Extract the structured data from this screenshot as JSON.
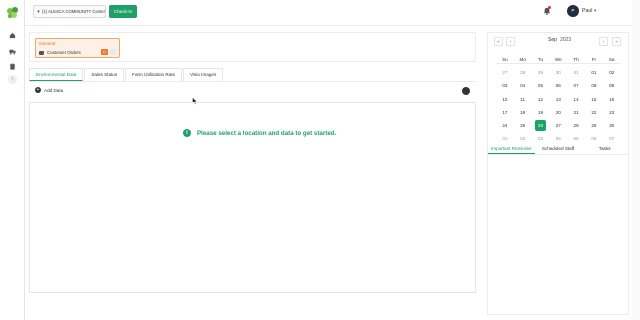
{
  "header": {
    "location": "(1) ALESCA COMMUNITY Center",
    "checkin_label": "Check-In",
    "user_initial": "P",
    "user_name": "Paul",
    "caret": "▾"
  },
  "sidebar": {
    "items": [
      {
        "icon": "home-icon"
      },
      {
        "icon": "truck-icon"
      },
      {
        "icon": "clipboard-icon"
      }
    ],
    "toggle": "›"
  },
  "summary": {
    "title": "General",
    "orders_label": "Customer Orders",
    "orders_count": "0"
  },
  "tabs": [
    {
      "label": "Environmental Data",
      "active": true
    },
    {
      "label": "Sales Status",
      "active": false
    },
    {
      "label": "Farm Utilization Rate",
      "active": false
    },
    {
      "label": "Visio Images",
      "active": false
    }
  ],
  "toolbar": {
    "add_data_label": "Add Data",
    "plus": "+"
  },
  "empty_state": {
    "icon": "i",
    "message": "Please select a location and data to get started."
  },
  "calendar": {
    "month": "Sep",
    "year": "2023",
    "nav": [
      "«",
      "‹",
      "›",
      "»"
    ],
    "weekdays": [
      "Su",
      "Mo",
      "Tu",
      "We",
      "Th",
      "Fr",
      "Sa"
    ],
    "weeks": [
      [
        "27",
        "28",
        "29",
        "30",
        "31",
        "01",
        "02"
      ],
      [
        "03",
        "04",
        "05",
        "06",
        "07",
        "08",
        "09"
      ],
      [
        "10",
        "11",
        "12",
        "13",
        "14",
        "15",
        "16"
      ],
      [
        "17",
        "18",
        "19",
        "20",
        "21",
        "22",
        "23"
      ],
      [
        "24",
        "25",
        "26",
        "27",
        "28",
        "29",
        "30"
      ],
      [
        "01",
        "02",
        "03",
        "04",
        "05",
        "06",
        "07"
      ]
    ],
    "today": "26"
  },
  "right_tabs": [
    {
      "label": "Important Reminder",
      "active": true
    },
    {
      "label": "Scheduled Staff",
      "active": false
    },
    {
      "label": "Tasks",
      "active": false
    }
  ],
  "colors": {
    "accent": "#1ea067",
    "warning": "#ef7a2f",
    "notification": "#e53935"
  }
}
